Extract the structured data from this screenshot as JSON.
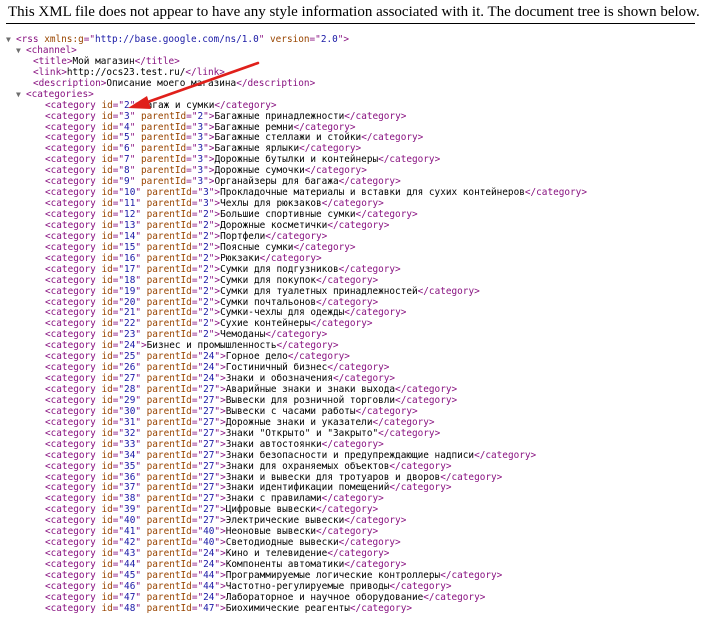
{
  "notice": "This XML file does not appear to have any style information associated with it. The document tree is shown below.",
  "rss": {
    "attrs": [
      [
        "xmlns:g",
        "http://base.google.com/ns/1.0"
      ],
      [
        "version",
        "2.0"
      ]
    ]
  },
  "channel": {
    "title": "Мой магазин",
    "link": "http://ocs23.test.ru/",
    "description": "Описание моего магазина"
  },
  "categories": [
    {
      "id": "2",
      "parent": null,
      "name": "Багаж и сумки"
    },
    {
      "id": "3",
      "parent": "2",
      "name": "Багажные принадлежности"
    },
    {
      "id": "4",
      "parent": "3",
      "name": "Багажные ремни"
    },
    {
      "id": "5",
      "parent": "3",
      "name": "Багажные стеллажи и стойки"
    },
    {
      "id": "6",
      "parent": "3",
      "name": "Багажные ярлыки"
    },
    {
      "id": "7",
      "parent": "3",
      "name": "Дорожные бутылки и контейнеры"
    },
    {
      "id": "8",
      "parent": "3",
      "name": "Дорожные сумочки"
    },
    {
      "id": "9",
      "parent": "3",
      "name": "Органайзеры для багажа"
    },
    {
      "id": "10",
      "parent": "3",
      "name": "Прокладочные материалы и вставки для сухих контейнеров"
    },
    {
      "id": "11",
      "parent": "3",
      "name": "Чехлы для рюкзаков"
    },
    {
      "id": "12",
      "parent": "2",
      "name": "Большие спортивные сумки"
    },
    {
      "id": "13",
      "parent": "2",
      "name": "Дорожные косметички"
    },
    {
      "id": "14",
      "parent": "2",
      "name": "Портфели"
    },
    {
      "id": "15",
      "parent": "2",
      "name": "Поясные сумки"
    },
    {
      "id": "16",
      "parent": "2",
      "name": "Рюкзаки"
    },
    {
      "id": "17",
      "parent": "2",
      "name": "Сумки для подгузников"
    },
    {
      "id": "18",
      "parent": "2",
      "name": "Сумки для покупок"
    },
    {
      "id": "19",
      "parent": "2",
      "name": "Сумки для туалетных принадлежностей"
    },
    {
      "id": "20",
      "parent": "2",
      "name": "Сумки почтальонов"
    },
    {
      "id": "21",
      "parent": "2",
      "name": "Сумки-чехлы для одежды"
    },
    {
      "id": "22",
      "parent": "2",
      "name": "Сухие контейнеры"
    },
    {
      "id": "23",
      "parent": "2",
      "name": "Чемоданы"
    },
    {
      "id": "24",
      "parent": null,
      "name": "Бизнес и промышленность"
    },
    {
      "id": "25",
      "parent": "24",
      "name": "Горное дело"
    },
    {
      "id": "26",
      "parent": "24",
      "name": "Гостиничный бизнес"
    },
    {
      "id": "27",
      "parent": "24",
      "name": "Знаки и обозначения"
    },
    {
      "id": "28",
      "parent": "27",
      "name": "Аварийные знаки и знаки выхода"
    },
    {
      "id": "29",
      "parent": "27",
      "name": "Вывески для розничной торговли"
    },
    {
      "id": "30",
      "parent": "27",
      "name": "Вывески с часами работы"
    },
    {
      "id": "31",
      "parent": "27",
      "name": "Дорожные знаки и указатели"
    },
    {
      "id": "32",
      "parent": "27",
      "name": "Знаки \"Открыто\" и \"Закрыто\""
    },
    {
      "id": "33",
      "parent": "27",
      "name": "Знаки автостоянки"
    },
    {
      "id": "34",
      "parent": "27",
      "name": "Знаки безопасности и предупреждающие надписи"
    },
    {
      "id": "35",
      "parent": "27",
      "name": "Знаки для охраняемых объектов"
    },
    {
      "id": "36",
      "parent": "27",
      "name": "Знаки и вывески для тротуаров и дворов"
    },
    {
      "id": "37",
      "parent": "27",
      "name": "Знаки идентификации помещений"
    },
    {
      "id": "38",
      "parent": "27",
      "name": "Знаки с правилами"
    },
    {
      "id": "39",
      "parent": "27",
      "name": "Цифровые вывески"
    },
    {
      "id": "40",
      "parent": "27",
      "name": "Электрические вывески"
    },
    {
      "id": "41",
      "parent": "40",
      "name": "Неоновые вывески"
    },
    {
      "id": "42",
      "parent": "40",
      "name": "Светодиодные вывески"
    },
    {
      "id": "43",
      "parent": "24",
      "name": "Кино и телевидение"
    },
    {
      "id": "44",
      "parent": "24",
      "name": "Компоненты автоматики"
    },
    {
      "id": "45",
      "parent": "44",
      "name": "Программируемые логические контроллеры"
    },
    {
      "id": "46",
      "parent": "44",
      "name": "Частотно-регулируемые приводы"
    },
    {
      "id": "47",
      "parent": "24",
      "name": "Лабораторное и научное оборудование"
    },
    {
      "id": "48",
      "parent": "47",
      "name": "Биохимические реагенты"
    }
  ],
  "colors": {
    "tag": "#881280",
    "attr_name": "#994500",
    "attr_value": "#1a1aa6",
    "text": "#000000",
    "arrow": "#e0201b"
  }
}
